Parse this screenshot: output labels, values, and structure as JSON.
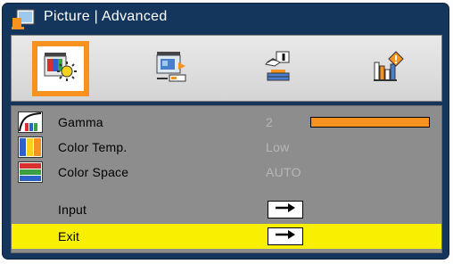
{
  "window": {
    "title": "Picture | Advanced",
    "icon": "picture-monitor-icon"
  },
  "tabs": [
    {
      "name": "picture-tab",
      "icon": "picture-brightness-icon",
      "selected": true
    },
    {
      "name": "display-tab",
      "icon": "screen-display-icon",
      "selected": false
    },
    {
      "name": "setup-tab",
      "icon": "hand-setup-icon",
      "selected": false
    },
    {
      "name": "options-tab",
      "icon": "options-info-icon",
      "selected": false
    }
  ],
  "menu": {
    "items": [
      {
        "label": "Gamma",
        "value": "2",
        "icon": "gamma-curve-icon",
        "level": 1.0
      },
      {
        "label": "Color Temp.",
        "value": "Low",
        "icon": "color-temp-icon"
      },
      {
        "label": "Color Space",
        "value": "AUTO",
        "icon": "color-space-icon"
      },
      {
        "label": "Input",
        "icon": "enter-arrow-icon"
      },
      {
        "label": "Exit",
        "icon": "enter-arrow-icon",
        "selected": true
      }
    ]
  },
  "colors": {
    "frame": "#15365c",
    "accent_orange": "#f7921e",
    "highlight_yellow": "#f8f000",
    "menu_gray": "#8d8d8d",
    "value_gray": "#b7b7b7"
  }
}
